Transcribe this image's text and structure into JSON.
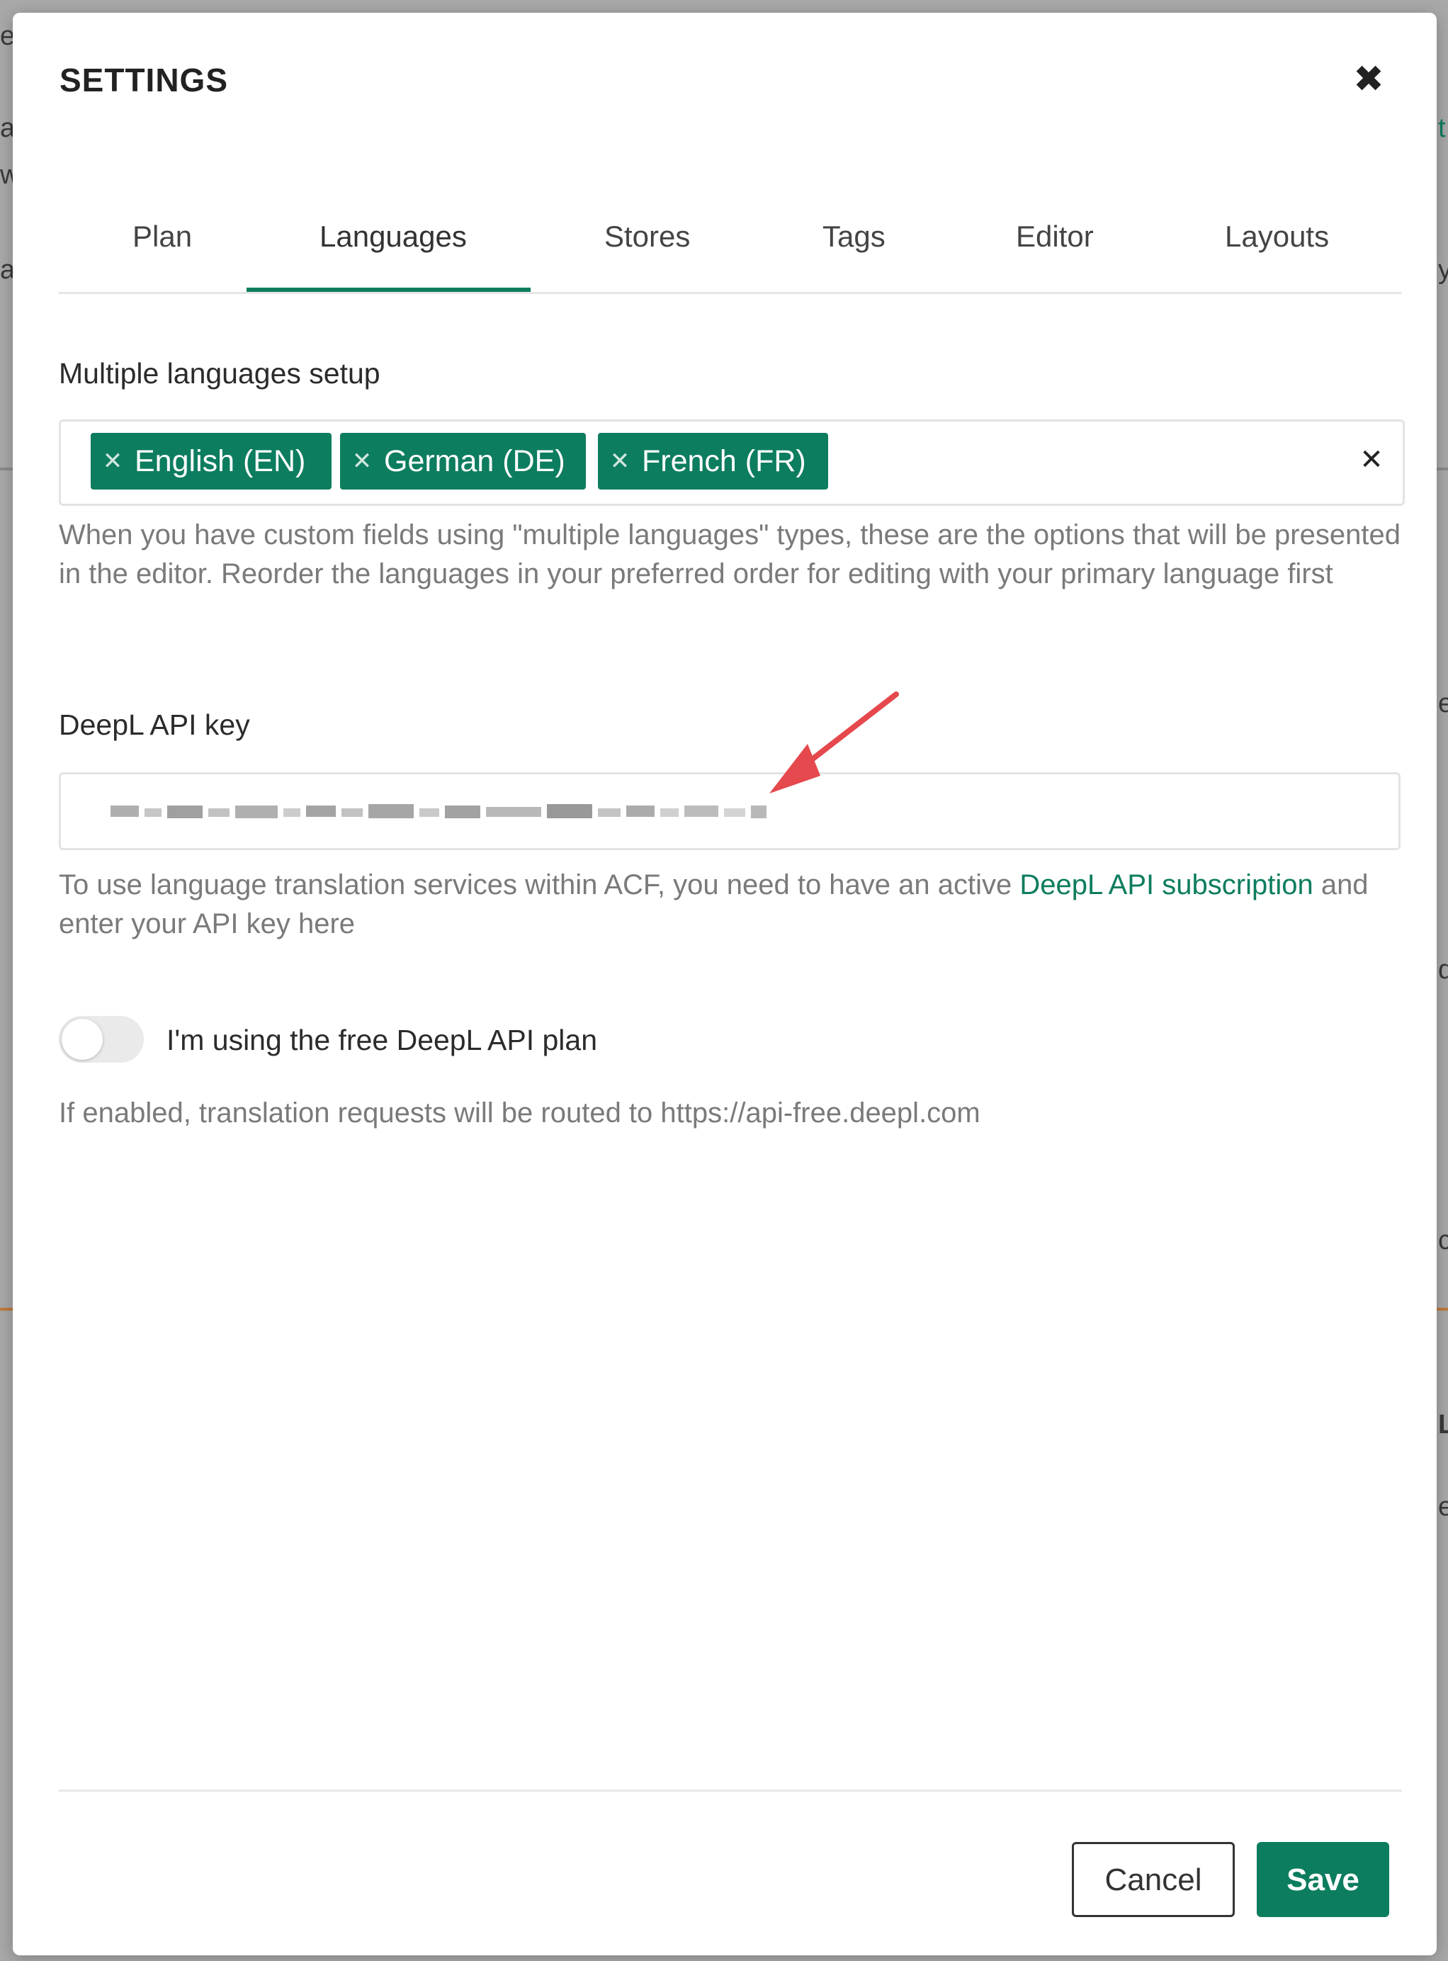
{
  "dialog": {
    "title": "SETTINGS"
  },
  "tabs": [
    {
      "label": "Plan"
    },
    {
      "label": "Languages",
      "active": true
    },
    {
      "label": "Stores"
    },
    {
      "label": "Tags"
    },
    {
      "label": "Editor"
    },
    {
      "label": "Layouts"
    }
  ],
  "languages": {
    "label": "Multiple languages setup",
    "selected": [
      {
        "label": "English (EN)"
      },
      {
        "label": "German (DE)"
      },
      {
        "label": "French (FR)"
      }
    ],
    "help": "When you have custom fields using \"multiple languages\" types, these are the options that will be presented in the editor. Reorder the languages in your preferred order for editing with your primary language first"
  },
  "deepl": {
    "label": "DeepL API key",
    "help_before": "To use language translation services within ACF, you need to have an active ",
    "help_link": "DeepL API subscription",
    "help_after": " and enter your API key here"
  },
  "free_plan": {
    "label": "I'm using the free DeepL API plan",
    "enabled": false,
    "help": "If enabled, translation requests will be routed to https://api-free.deepl.com"
  },
  "footer": {
    "cancel_label": "Cancel",
    "save_label": "Save"
  },
  "colors": {
    "accent": "#0d7d5f",
    "annotation_arrow": "#e5484d"
  },
  "background": {
    "fragments": [
      "e",
      "a",
      "w",
      "a",
      "t",
      "y",
      "e",
      "d",
      "c",
      "L",
      "e"
    ]
  }
}
